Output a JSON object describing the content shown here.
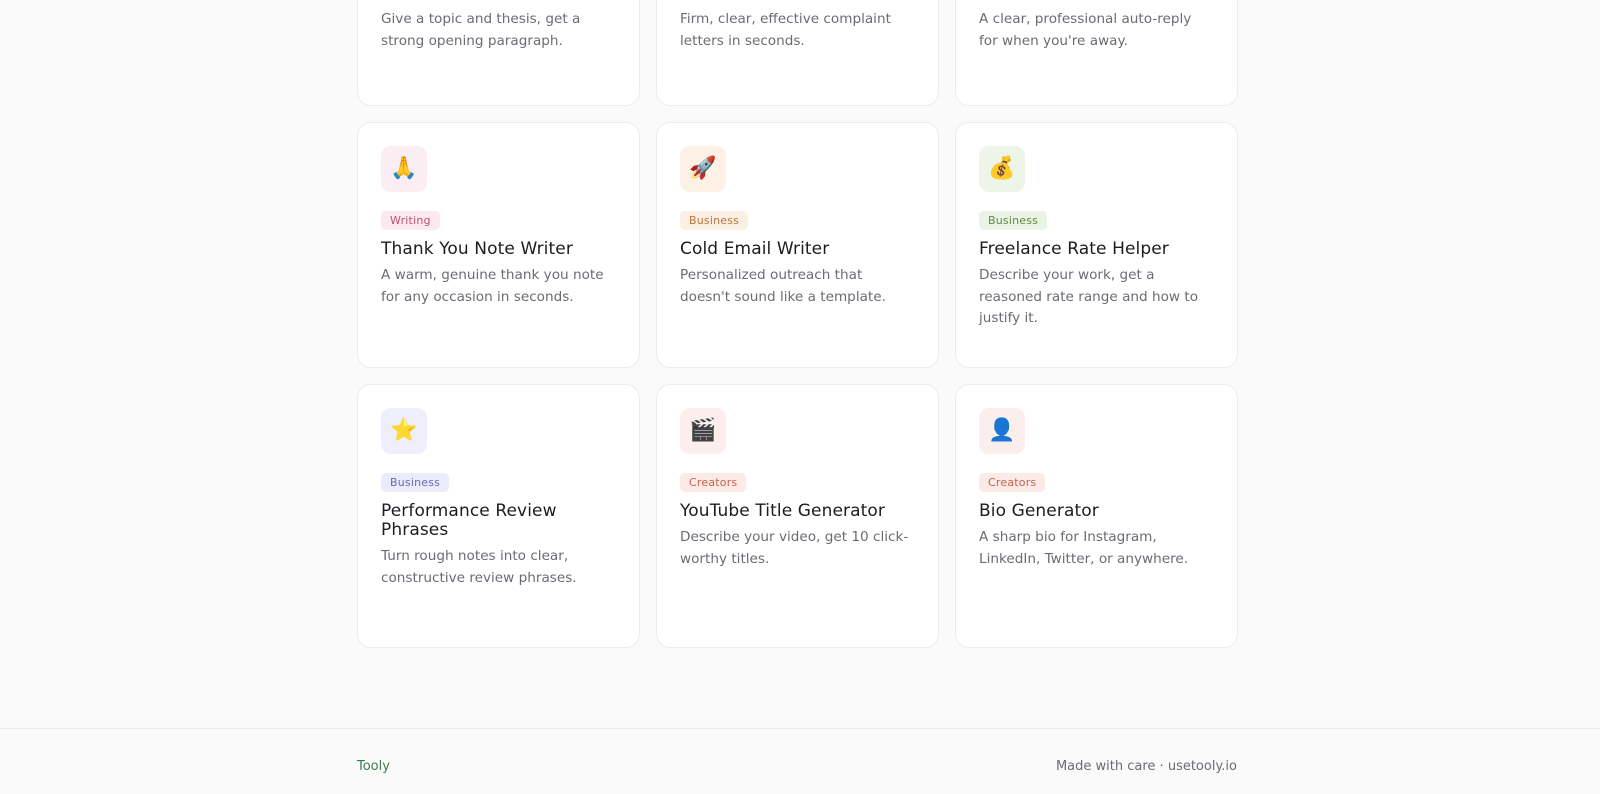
{
  "top_row_cards": [
    {
      "description": "Give a topic and thesis, get a strong opening paragraph."
    },
    {
      "description": "Firm, clear, effective complaint letters in seconds."
    },
    {
      "description": "A clear, professional auto-reply for when you're away."
    }
  ],
  "tool_cards": [
    {
      "icon": "praying-hands-icon",
      "glyph": "🙏",
      "category": "Writing",
      "title": "Thank You Note Writer",
      "description": "A warm, genuine thank you note for any occasion in seconds."
    },
    {
      "icon": "rocket-icon",
      "glyph": "🚀",
      "category": "Business",
      "title": "Cold Email Writer",
      "description": "Personalized outreach that doesn't sound like a template."
    },
    {
      "icon": "money-bag-icon",
      "glyph": "💰",
      "category": "Business",
      "title": "Freelance Rate Helper",
      "description": "Describe your work, get a reasoned rate range and how to justify it."
    },
    {
      "icon": "star-icon",
      "glyph": "⭐",
      "category": "Business",
      "title": "Performance Review Phrases",
      "description": "Turn rough notes into clear, constructive review phrases."
    },
    {
      "icon": "clapperboard-icon",
      "glyph": "🎬",
      "category": "Creators",
      "title": "YouTube Title Generator",
      "description": "Describe your video, get 10 click-worthy titles."
    },
    {
      "icon": "person-silhouette-icon",
      "glyph": "👤",
      "category": "Creators",
      "title": "Bio Generator",
      "description": "A sharp bio for Instagram, LinkedIn, Twitter, or anywhere."
    }
  ],
  "colors": {
    "writing_badge": "#c2516f",
    "business_badge_orange": "#b8763d",
    "business_badge_green": "#5f8a47",
    "business_badge_purple": "#6f65b6",
    "creators_badge": "#c4634f",
    "brand": "#3f7a52"
  },
  "footer": {
    "brand": "Tooly",
    "made_with": "Made with care · ",
    "site": "usetooly.io"
  }
}
